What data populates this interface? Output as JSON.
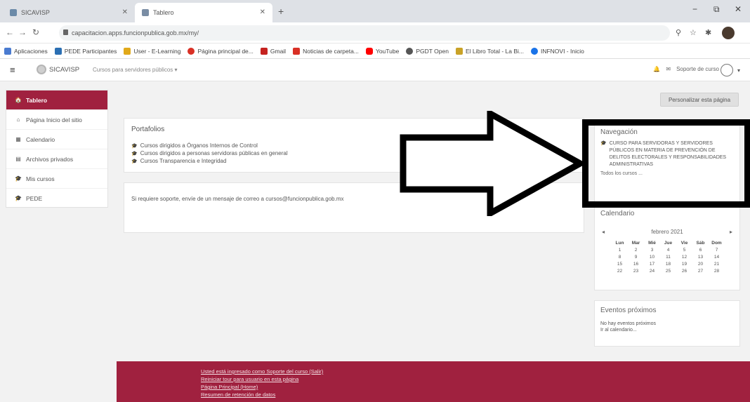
{
  "browser": {
    "tabs": [
      {
        "label": "SICAVISP",
        "active": false
      },
      {
        "label": "Tablero",
        "active": true
      }
    ],
    "new_tab": "+",
    "url": "capacitacion.apps.funcionpublica.gob.mx/my/",
    "window_controls": [
      "−",
      "⧉",
      "✕"
    ],
    "bookmarks": [
      {
        "label": "Aplicaciones",
        "color": "#4a7bd0"
      },
      {
        "label": "PEDE Participantes",
        "color": "#2b6fb3"
      },
      {
        "label": "User - E-Learning",
        "color": "#e1a91a"
      },
      {
        "label": "Página principal de...",
        "color": "#d93025"
      },
      {
        "label": "Gmail",
        "color": "#c5221f"
      },
      {
        "label": "Noticias de carpeta...",
        "color": "#d93025"
      },
      {
        "label": "YouTube",
        "color": "#ff0000"
      },
      {
        "label": "PGDT Open",
        "color": "#555555"
      },
      {
        "label": "El Libro Total - La Bi...",
        "color": "#c9a227"
      },
      {
        "label": "INFNOVI - Inicio",
        "color": "#1a73e8"
      }
    ]
  },
  "navbar": {
    "site_name": "SICAVISP",
    "course_menu": "Cursos para servidores públicos ▾",
    "user_name": "Soporte de curso",
    "caret": "▾"
  },
  "sidebar": {
    "items": [
      {
        "label": "Tablero",
        "icon": "🏠",
        "active": true
      },
      {
        "label": "Página Inicio del sitio",
        "icon": "⌂",
        "active": false
      },
      {
        "label": "Calendario",
        "icon": "▦",
        "active": false
      },
      {
        "label": "Archivos privados",
        "icon": "▤",
        "active": false
      },
      {
        "label": "Mis cursos",
        "icon": "🎓",
        "active": false
      },
      {
        "label": "PEDE",
        "icon": "🎓",
        "active": false
      }
    ]
  },
  "main": {
    "customize_button": "Personalizar esta página",
    "panel_title": "Portafolios",
    "course_links": [
      "Cursos dirigidos a Órganos Internos de Control",
      "Cursos dirigidos a personas servidoras públicas en general",
      "Cursos Transparencia e Integridad"
    ],
    "support_text": "Si requiere soporte, envíe de un mensaje de correo a cursos@funcionpublica.gob.mx"
  },
  "right_blocks": {
    "courses_title": "Navegación",
    "courses_link": "CURSO PARA SERVIDORAS Y SERVIDORES PÚBLICOS EN MATERIA DE PREVENCIÓN DE DELITOS ELECTORALES Y RESPONSABILIDADES ADMINISTRATIVAS",
    "all_courses": "Todos los cursos ...",
    "calendar_title": "Calendario",
    "calendar_month": "febrero 2021",
    "calendar_prev": "◂",
    "calendar_next": "▸",
    "weekdays": [
      "Lun",
      "Mar",
      "Mié",
      "Jue",
      "Vie",
      "Sáb",
      "Dom"
    ],
    "weeks": [
      [
        "1",
        "2",
        "3",
        "4",
        "5",
        "6",
        "7"
      ],
      [
        "8",
        "9",
        "10",
        "11",
        "12",
        "13",
        "14"
      ],
      [
        "15",
        "16",
        "17",
        "18",
        "19",
        "20",
        "21"
      ],
      [
        "22",
        "23",
        "24",
        "25",
        "26",
        "27",
        "28"
      ]
    ],
    "events_title": "Eventos próximos",
    "events_empty": "No hay eventos próximos",
    "events_link": "Ir al calendario..."
  },
  "footer": {
    "links": [
      "Usted está ingresado como Soporte del curso (Salir)",
      "Reiniciar tour para usuario en esta página",
      "Página Principal (Home)",
      "Resumen de retención de datos"
    ]
  }
}
